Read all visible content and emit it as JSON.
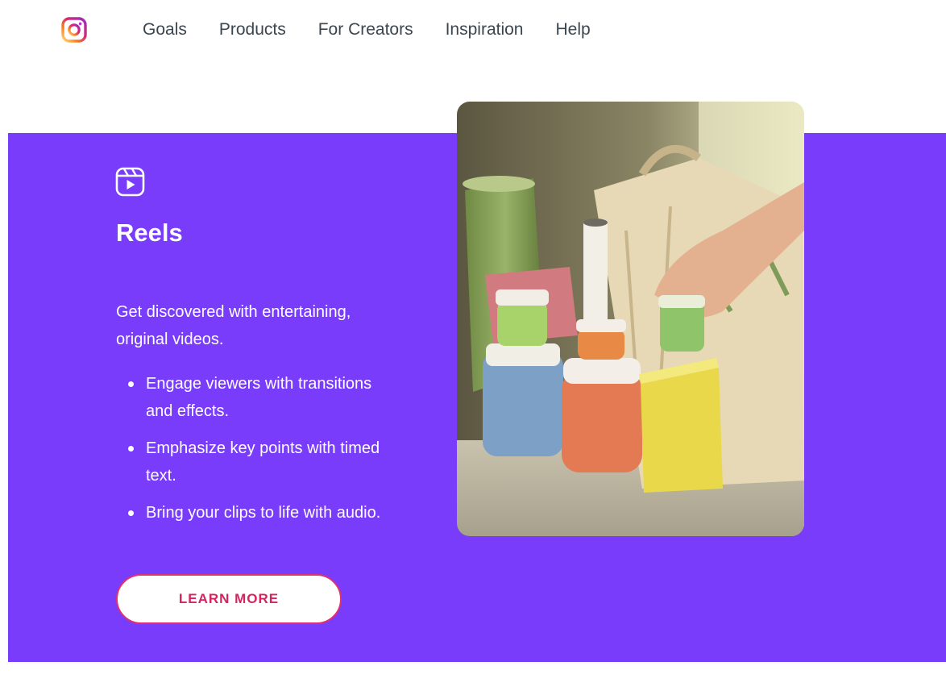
{
  "nav": {
    "logo_icon": "instagram-logo",
    "items": [
      "Goals",
      "Products",
      "For Creators",
      "Inspiration",
      "Help"
    ]
  },
  "feature": {
    "icon": "reels-icon",
    "title": "Reels",
    "lead": "Get discovered with entertaining, original videos.",
    "bullets": [
      "Engage viewers with transitions and effects.",
      "Emphasize key points with timed text.",
      "Bring your clips to life with audio."
    ],
    "cta_label": "LEARN MORE"
  },
  "media": {
    "alt": "product-photo"
  },
  "colors": {
    "band": "#7a3cfb",
    "cta_text": "#d6245e",
    "nav_text": "#3b4650"
  }
}
